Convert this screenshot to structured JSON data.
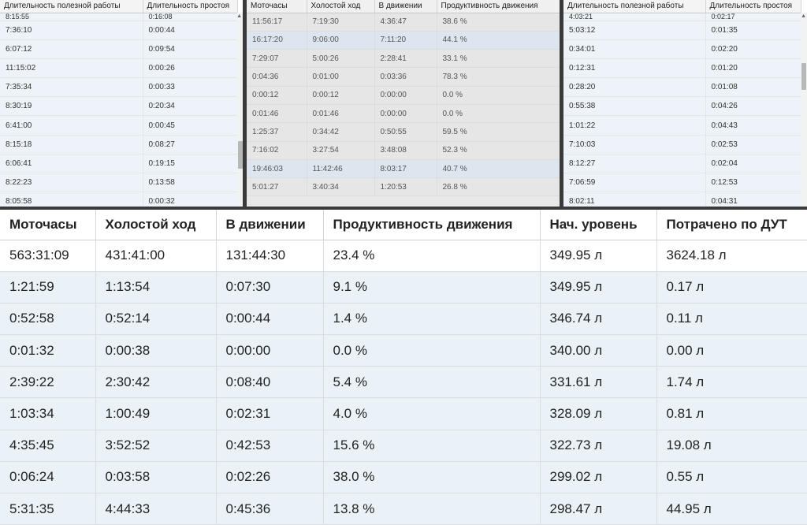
{
  "panel_left": {
    "headers": [
      "Длительность полезной работы",
      "Длительность простоя"
    ],
    "rows": [
      [
        "8:15:55",
        "0:16:08"
      ],
      [
        "7:36:10",
        "0:00:44"
      ],
      [
        "6:07:12",
        "0:09:54"
      ],
      [
        "11:15:02",
        "0:00:26"
      ],
      [
        "7:35:34",
        "0:00:33"
      ],
      [
        "8:30:19",
        "0:20:34"
      ],
      [
        "6:41:00",
        "0:00:45"
      ],
      [
        "8:15:18",
        "0:08:27"
      ],
      [
        "6:06:41",
        "0:19:15"
      ],
      [
        "8:22:23",
        "0:13:58"
      ],
      [
        "8:05:58",
        "0:00:32"
      ]
    ]
  },
  "panel_middle": {
    "headers": [
      "Моточасы",
      "Холостой ход",
      "В движении",
      "Продуктивность движения"
    ],
    "rows": [
      [
        "11:56:17",
        "7:19:30",
        "4:36:47",
        "38.6 %"
      ],
      [
        "16:17:20",
        "9:06:00",
        "7:11:20",
        "44.1 %"
      ],
      [
        "7:29:07",
        "5:00:26",
        "2:28:41",
        "33.1 %"
      ],
      [
        "0:04:36",
        "0:01:00",
        "0:03:36",
        "78.3 %"
      ],
      [
        "0:00:12",
        "0:00:12",
        "0:00:00",
        "0.0 %"
      ],
      [
        "0:01:46",
        "0:01:46",
        "0:00:00",
        "0.0 %"
      ],
      [
        "1:25:37",
        "0:34:42",
        "0:50:55",
        "59.5 %"
      ],
      [
        "7:16:02",
        "3:27:54",
        "3:48:08",
        "52.3 %"
      ],
      [
        "19:46:03",
        "11:42:46",
        "8:03:17",
        "40.7 %"
      ],
      [
        "5:01:27",
        "3:40:34",
        "1:20:53",
        "26.8 %"
      ]
    ]
  },
  "panel_right": {
    "headers": [
      "Длительность полезной работы",
      "Длительность простоя"
    ],
    "rows": [
      [
        "4:03:21",
        "0:02:17"
      ],
      [
        "5:03:12",
        "0:01:35"
      ],
      [
        "0:34:01",
        "0:02:20"
      ],
      [
        "0:12:31",
        "0:01:20"
      ],
      [
        "0:28:20",
        "0:01:08"
      ],
      [
        "0:55:38",
        "0:04:26"
      ],
      [
        "1:01:22",
        "0:04:43"
      ],
      [
        "7:10:03",
        "0:02:53"
      ],
      [
        "8:12:27",
        "0:02:04"
      ],
      [
        "7:06:59",
        "0:12:53"
      ],
      [
        "8:02:11",
        "0:04:31"
      ]
    ]
  },
  "main_table": {
    "headers": [
      "Моточасы",
      "Холостой ход",
      "В движении",
      "Продуктивность движения",
      "Нач. уровень",
      "Потрачено по ДУТ"
    ],
    "total": [
      "563:31:09",
      "431:41:00",
      "131:44:30",
      "23.4 %",
      "349.95 л",
      "3624.18 л"
    ],
    "rows": [
      [
        "1:21:59",
        "1:13:54",
        "0:07:30",
        "9.1 %",
        "349.95 л",
        "0.17 л"
      ],
      [
        "0:52:58",
        "0:52:14",
        "0:00:44",
        "1.4 %",
        "346.74 л",
        "0.11 л"
      ],
      [
        "0:01:32",
        "0:00:38",
        "0:00:00",
        "0.0 %",
        "340.00 л",
        "0.00 л"
      ],
      [
        "2:39:22",
        "2:30:42",
        "0:08:40",
        "5.4 %",
        "331.61 л",
        "1.74 л"
      ],
      [
        "1:03:34",
        "1:00:49",
        "0:02:31",
        "4.0 %",
        "328.09 л",
        "0.81 л"
      ],
      [
        "4:35:45",
        "3:52:52",
        "0:42:53",
        "15.6 %",
        "322.73 л",
        "19.08 л"
      ],
      [
        "0:06:24",
        "0:03:58",
        "0:02:26",
        "38.0 %",
        "299.02 л",
        "0.55 л"
      ],
      [
        "5:31:35",
        "4:44:33",
        "0:45:36",
        "13.8 %",
        "298.47 л",
        "44.95 л"
      ]
    ]
  },
  "colors": {
    "row_bg": "#eaf2f8",
    "header_bg": "#ffffff",
    "separator": "#3a3a3a"
  }
}
